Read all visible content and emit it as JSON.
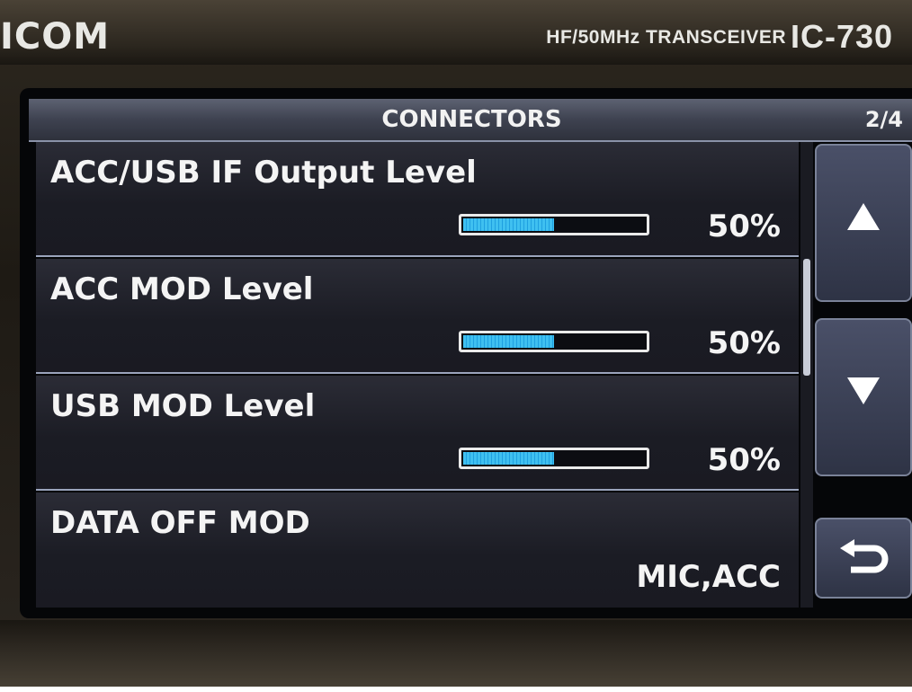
{
  "device": {
    "brand": "ICOM",
    "description": "HF/50MHz TRANSCEIVER",
    "model": "IC-730"
  },
  "screen": {
    "title": "CONNECTORS",
    "page": "2/4",
    "items": [
      {
        "label": "ACC/USB IF Output Level",
        "value": "50%",
        "level": 0.5
      },
      {
        "label": "ACC MOD Level",
        "value": "50%",
        "level": 0.5
      },
      {
        "label": "USB MOD Level",
        "value": "50%",
        "level": 0.5
      },
      {
        "label": "DATA OFF MOD",
        "value": "MIC,ACC"
      }
    ],
    "buttons": {
      "up_icon": "triangle-up-icon",
      "down_icon": "triangle-down-icon",
      "back_icon": "return-arrow-icon"
    }
  },
  "colors": {
    "meter_fill": "#3fc0f0",
    "title_bar": "#4a4e5e",
    "screen_bg": "#050608"
  }
}
